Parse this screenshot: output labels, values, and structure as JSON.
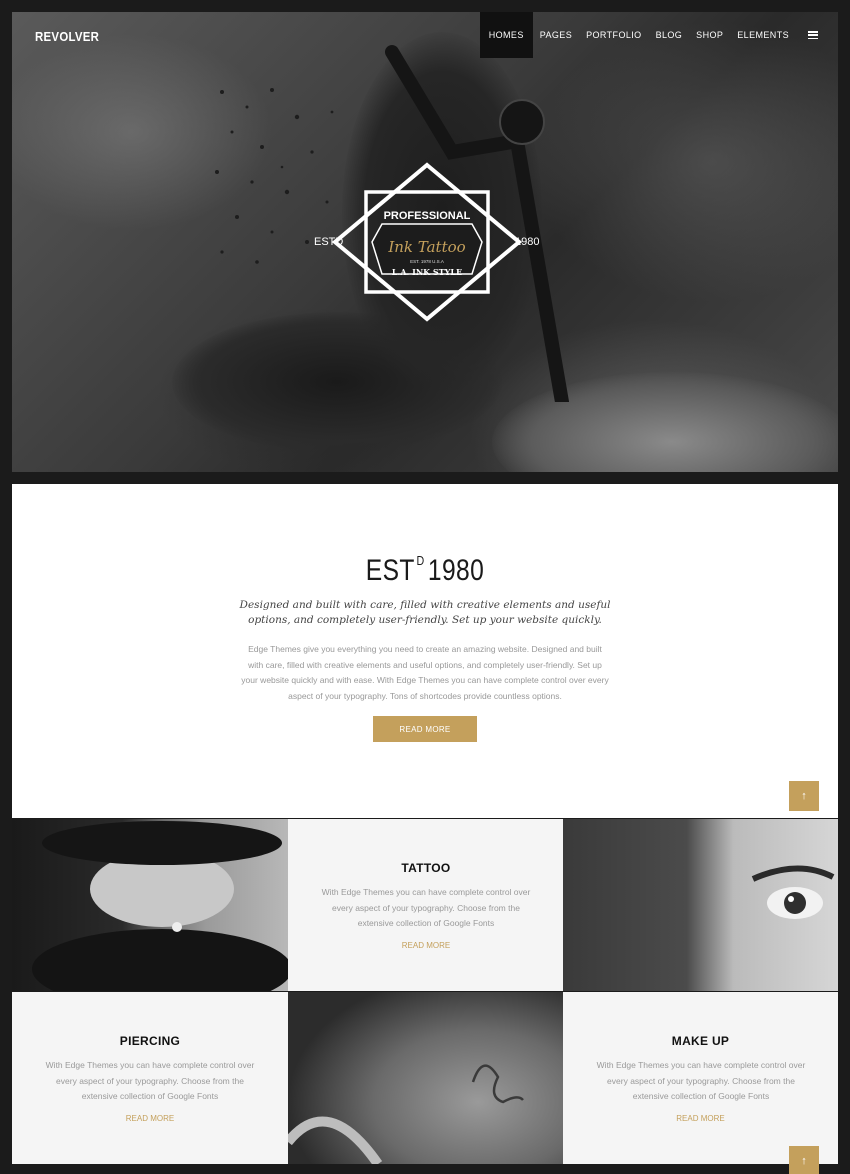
{
  "nav": {
    "logo": "REVOLVER",
    "items": [
      {
        "label": "HOMES",
        "active": true
      },
      {
        "label": "PAGES"
      },
      {
        "label": "PORTFOLIO"
      },
      {
        "label": "BLOG"
      },
      {
        "label": "SHOP"
      },
      {
        "label": "ELEMENTS"
      }
    ],
    "menu_icon": "hamburger-icon"
  },
  "hero": {
    "badge_top": "PROFESSIONAL",
    "badge_script": "Ink Tattoo",
    "badge_small": "EST. 1978 U.S.A",
    "badge_bottom": "L.A. INK STYLE",
    "est_left": "ESTD",
    "est_right": "1980"
  },
  "intro": {
    "title_main": "EST",
    "title_sup": "D",
    "title_year": "1980",
    "subtitle": "Designed and built with care, filled with creative elements and useful options, and completely user-friendly. Set up your website quickly.",
    "body": "Edge Themes give you everything you need to create an amazing website.  Designed and built with care, filled with creative elements and useful options, and completely user-friendly. Set up your website quickly and with ease. With Edge Themes you can have complete control over every aspect of your typography. Tons of shortcodes provide countless options.",
    "button": "READ MORE"
  },
  "services": [
    {
      "title": "TATTOO",
      "body": "With Edge Themes you can have complete control over every aspect of your typography. Choose from the extensive collection of Google Fonts",
      "link": "READ MORE"
    },
    {
      "title": "PIERCING",
      "body": "With Edge Themes you can have complete control over every aspect of your typography. Choose from the extensive collection of Google Fonts",
      "link": "READ MORE"
    },
    {
      "title": "MAKE UP",
      "body": "With Edge Themes you can have complete control over every aspect of your typography. Choose from the extensive collection of Google Fonts",
      "link": "READ MORE"
    }
  ],
  "scroll_top_label": "↑",
  "colors": {
    "accent": "#c4a05c",
    "dark": "#1b1b1b"
  }
}
